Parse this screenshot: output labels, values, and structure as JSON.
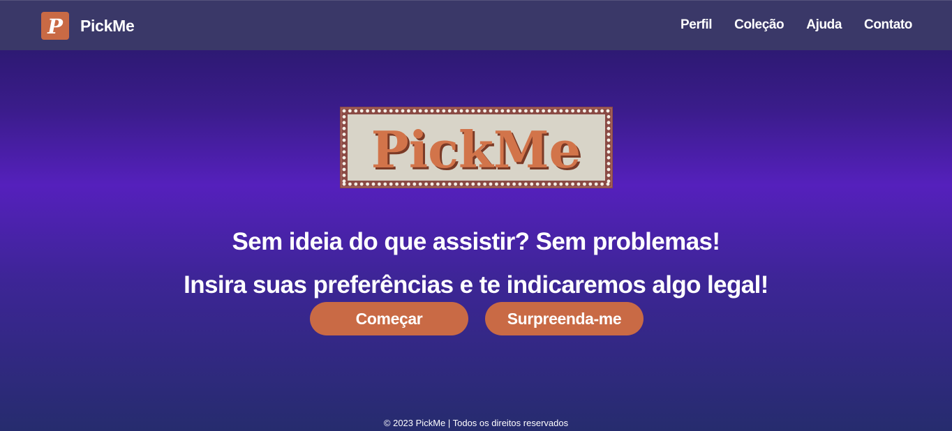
{
  "brand": {
    "name": "PickMe",
    "logo_letter": "P",
    "color": "#c96a45"
  },
  "nav": {
    "items": [
      {
        "label": "Perfil"
      },
      {
        "label": "Coleção"
      },
      {
        "label": "Ajuda"
      },
      {
        "label": "Contato"
      }
    ]
  },
  "hero": {
    "marquee_text": "PickMe",
    "headline_line1": "Sem ideia do que assistir? Sem problemas!",
    "headline_line2": "Insira suas preferências e te indicaremos algo legal!",
    "buttons": {
      "start": "Começar",
      "surprise": "Surpreenda-me"
    }
  },
  "footer": {
    "text": "© 2023 PickMe | Todos os direitos reservados"
  },
  "colors": {
    "accent": "#c96a45",
    "navbar": "#3a3868",
    "marquee_panel": "#d8d4c8",
    "marquee_frame": "#8a4a44"
  }
}
